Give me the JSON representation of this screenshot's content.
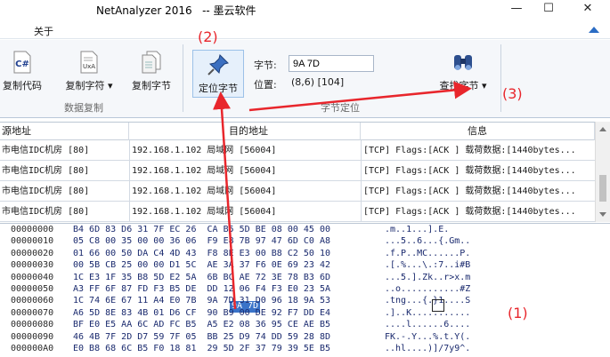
{
  "window": {
    "title": "NetAnalyzer 2016   -- 墨云软件",
    "minimize": "—",
    "maximize": "☐",
    "close": "✕"
  },
  "menu": {
    "about": "关于"
  },
  "ribbon": {
    "copy_code": "复制代码",
    "copy_chars": "复制字符",
    "copy_bytes": "复制字节",
    "group_data_copy": "数据复制",
    "locate_byte": "定位字节",
    "byte_label": "字节:",
    "byte_value": "9A 7D",
    "position_label": "位置:",
    "position_value": "(8,6) [104]",
    "find_bytes": "查找字节",
    "group_byte_locate": "字节定位",
    "dropdown_glyph": "▾",
    "csharp_icon_text": "C#",
    "uxa_icon_text": "UxA"
  },
  "grid": {
    "columns": [
      "源地址",
      "目的地址",
      "信息"
    ],
    "rows": [
      {
        "src": "市电信IDC机房 [80]",
        "dst": "192.168.1.102 局域网 [56004]",
        "info": "[TCP] Flags:[ACK ] 载荷数据:[1440bytes..."
      },
      {
        "src": "市电信IDC机房 [80]",
        "dst": "192.168.1.102 局域网 [56004]",
        "info": "[TCP] Flags:[ACK ] 载荷数据:[1440bytes..."
      },
      {
        "src": "市电信IDC机房 [80]",
        "dst": "192.168.1.102 局域网 [56004]",
        "info": "[TCP] Flags:[ACK ] 载荷数据:[1440bytes..."
      },
      {
        "src": "市电信IDC机房 [80]",
        "dst": "192.168.1.102 局域网 [56004]",
        "info": "[TCP] Flags:[ACK ] 载荷数据:[1440bytes..."
      }
    ]
  },
  "hex": {
    "lines": [
      {
        "offset": "00000000",
        "bytes": "B4 6D 83 D6 31 7F EC 26  CA B5 5D BE 08 00 45 00",
        "ascii": ".m..1...].E."
      },
      {
        "offset": "00000010",
        "bytes": "05 C8 00 35 00 00 36 06  F9 E8 7B 97 47 6D C0 A8",
        "ascii": "...5..6...{.Gm.."
      },
      {
        "offset": "00000020",
        "bytes": "01 66 00 50 DA C4 4D 43  F8 8E E3 00 B8 C2 50 10",
        "ascii": ".f.P..MC......P."
      },
      {
        "offset": "00000030",
        "bytes": "00 5B CB 25 00 00 D1 5C  AE 3A 37 F6 0E 69 23 42",
        "ascii": ".[.%...\\.:7..i#B"
      },
      {
        "offset": "00000040",
        "bytes": "1C E3 1F 35 B8 5D E2 5A  6B BC AE 72 3E 78 B3 6D",
        "ascii": "...5.].Zk..r>x.m"
      },
      {
        "offset": "00000050",
        "bytes": "A3 FF 6F 87 FD F3 B5 DE  DD 12 06 F4 F3 E0 23 5A",
        "ascii": "..o...........#Z"
      },
      {
        "offset": "00000060",
        "bytes": "1C 74 6E 67 11 A4 E0 7B  9A 7D 31 D0 96 18 9A 53",
        "ascii": ".tng...{.}1....S"
      },
      {
        "offset": "00000070",
        "bytes": "A6 5D 8E 83 4B 01 D6 CF  90 B9 00 DE 92 F7 DD E4",
        "ascii": ".]..K..........."
      },
      {
        "offset": "00000080",
        "bytes": "BF E0 E5 AA 6C AD FC B5  A5 E2 08 36 95 CE AE B5",
        "ascii": "....l......6...."
      },
      {
        "offset": "00000090",
        "bytes": "46 4B 7F 2D D7 59 7F 05  BB 25 D9 74 DD 59 28 8D",
        "ascii": "FK.-.Y...%.t.Y(."
      },
      {
        "offset": "000000A0",
        "bytes": "E0 B8 68 6C B5 F0 18 81  29 5D 2F 37 79 39 5E B5",
        "ascii": "..hl....)]/7y9^."
      }
    ],
    "highlight": "9A 7D"
  },
  "annotations": {
    "a1": "(1)",
    "a2": "(2)",
    "a3": "(3)"
  },
  "colors": {
    "accent": "#2b6cc4",
    "annotation": "#e8262c",
    "highlight": "#3a73c8"
  }
}
